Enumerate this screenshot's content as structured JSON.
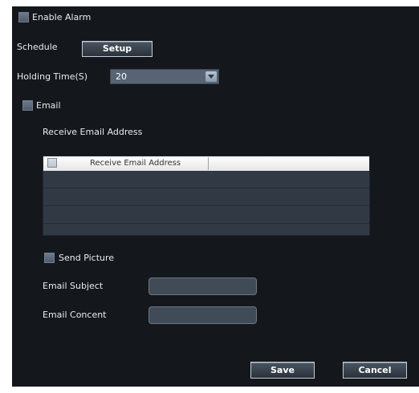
{
  "alarm": {
    "enable_label": "Enable Alarm",
    "enabled": false
  },
  "schedule": {
    "label": "Schedule",
    "button_label": "Setup"
  },
  "holding_time": {
    "label": "Holding Time(S)",
    "value": "20"
  },
  "email": {
    "label": "Email",
    "enabled": false,
    "receive_address_title": "Receive Email Address",
    "table": {
      "column_header": "Receive Email Address",
      "rows": [
        "",
        "",
        "",
        ""
      ]
    },
    "send_picture_label": "Send Picture",
    "subject_label": "Email Subject",
    "subject_value": "",
    "content_label": "Email Concent",
    "content_value": ""
  },
  "actions": {
    "save_label": "Save",
    "cancel_label": "Cancel"
  }
}
